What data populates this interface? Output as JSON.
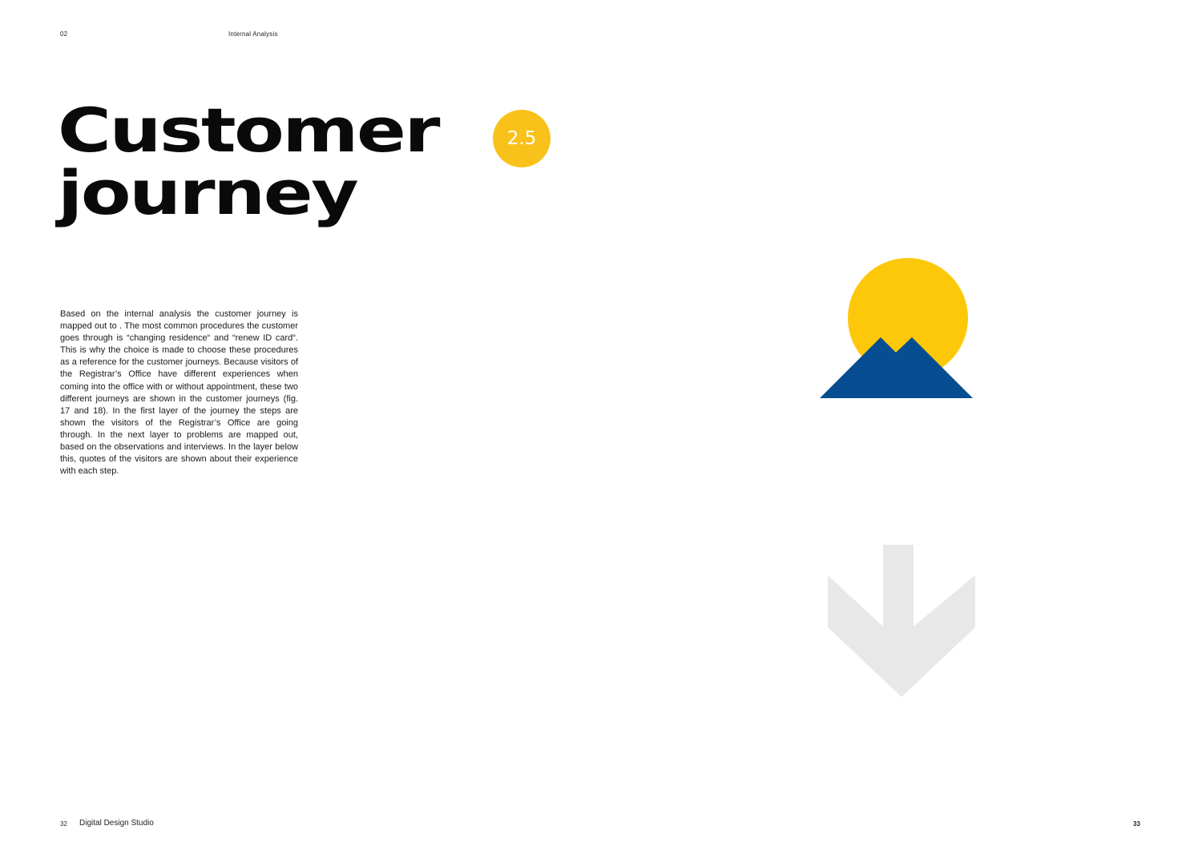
{
  "header": {
    "chapter_number": "02",
    "section": "Internal Analysis"
  },
  "title": {
    "line1": "Customer",
    "line2": "journey"
  },
  "badge": "2.5",
  "body": "Based on the internal analysis the customer journey is mapped out to . The most common procedures the customer goes through is “changing residence“ and “renew ID card“. This is why the choice is made to choose these procedures as a reference for the customer journeys. Because visitors of the Registrar’s Office have different experiences when coming into the office with or without appointment, these two different journeys are shown in the customer journeys (fig. 17 and 18). In the first layer of the journey the steps are shown the visitors of the Registrar’s Office are going through. In the next layer to problems are mapped out, based on the observations and interviews. In the layer below this, quotes of the visitors are shown about their experience with each step.",
  "illustrations": {
    "top": "sun-over-mountains-icon",
    "bottom": "arrow-down-icon"
  },
  "footer": {
    "left_page": "32",
    "studio": "Digital Design Studio",
    "right_page": "33"
  },
  "colors": {
    "yellow": "#f9c21b",
    "sun": "#fec80a",
    "blue": "#064e91",
    "arrow_gray": "#e8e8e8"
  }
}
